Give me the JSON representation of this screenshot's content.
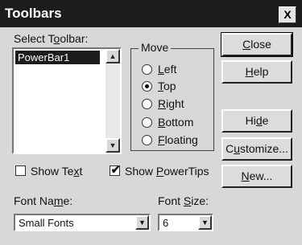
{
  "window": {
    "title": "Toolbars",
    "close_glyph": "X"
  },
  "toolbar_list": {
    "label_pre": "Select T",
    "label_key": "o",
    "label_post": "olbar:",
    "items": [
      "PowerBar1"
    ],
    "scroll_up_icon": "▲",
    "scroll_down_icon": "▼"
  },
  "move_group": {
    "title": "Move",
    "options": [
      {
        "key": "L",
        "rest": "eft",
        "checked": false
      },
      {
        "key": "T",
        "rest": "op",
        "checked": true
      },
      {
        "key": "R",
        "rest": "ight",
        "checked": false
      },
      {
        "key": "B",
        "rest": "ottom",
        "checked": false
      },
      {
        "key": "F",
        "rest": "loating",
        "checked": false
      }
    ]
  },
  "buttons": {
    "close": {
      "key": "C",
      "rest": "lose"
    },
    "help": {
      "key": "H",
      "rest": "elp"
    },
    "hide": {
      "pre": "Hi",
      "key": "d",
      "rest": "e"
    },
    "customize": {
      "pre": "C",
      "key": "u",
      "rest": "stomize..."
    },
    "new": {
      "key": "N",
      "rest": "ew..."
    }
  },
  "checkboxes": {
    "show_text": {
      "label": "Show Te",
      "key": "x",
      "rest": "t",
      "checked": false
    },
    "show_tips": {
      "label": "Show ",
      "key": "P",
      "rest": "owerTips",
      "checked": true,
      "mark": "✔"
    }
  },
  "font_name": {
    "label_pre": "Font Na",
    "label_key": "m",
    "label_post": "e:",
    "value": "Small Fonts",
    "arrow_icon": "▼"
  },
  "font_size": {
    "label_pre": "Font ",
    "label_key": "S",
    "label_post": "ize:",
    "value": "6",
    "arrow_icon": "▼"
  }
}
